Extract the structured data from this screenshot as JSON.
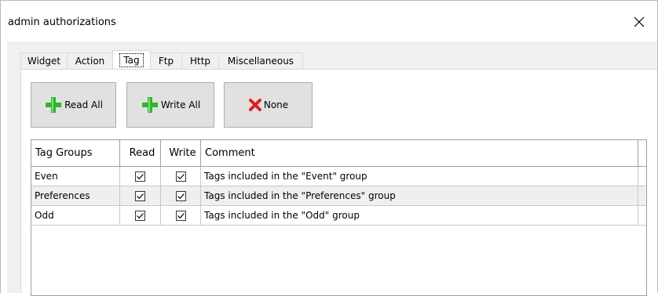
{
  "window": {
    "title": "admin authorizations",
    "close_glyph": "✕"
  },
  "tabs": [
    {
      "label": "Widget",
      "active": false
    },
    {
      "label": "Action",
      "active": false
    },
    {
      "label": "Tag",
      "active": true
    },
    {
      "label": "Ftp",
      "active": false
    },
    {
      "label": "Http",
      "active": false
    },
    {
      "label": "Miscellaneous",
      "active": false
    }
  ],
  "buttons": {
    "read_all": {
      "label": "Read All",
      "icon": "green-plus-icon"
    },
    "write_all": {
      "label": "Write All",
      "icon": "green-plus-icon"
    },
    "none": {
      "label": "None",
      "icon": "red-x-icon"
    }
  },
  "table": {
    "columns": [
      "Tag Groups",
      "Read",
      "Write",
      "Comment"
    ],
    "rows": [
      {
        "group": "Even",
        "read": true,
        "write": true,
        "comment": "Tags included in the \"Event\" group"
      },
      {
        "group": "Preferences",
        "read": true,
        "write": true,
        "comment": "Tags included in the \"Preferences\" group"
      },
      {
        "group": "Odd",
        "read": true,
        "write": true,
        "comment": "Tags included in the \"Odd\" group"
      }
    ]
  },
  "colors": {
    "plus_green": "#2fb52f",
    "x_red": "#e02020",
    "button_bg": "#e1e1e1",
    "dialog_bg": "#f0f0f0",
    "alt_row": "#efefef"
  }
}
